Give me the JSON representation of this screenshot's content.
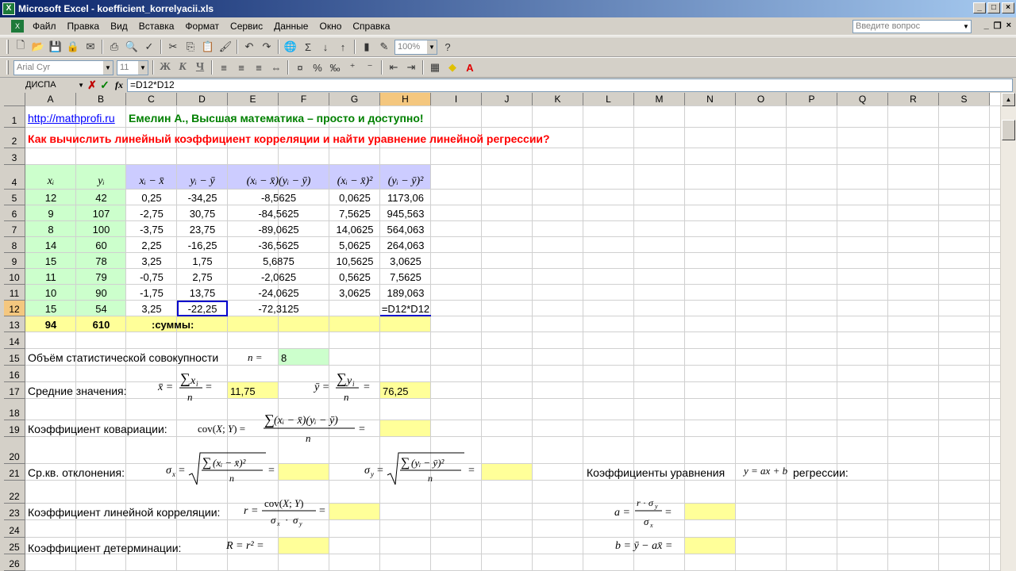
{
  "window": {
    "title": "Microsoft Excel - koefficient_korrelyacii.xls",
    "icon": "excel-icon"
  },
  "menu": {
    "items": [
      "Файл",
      "Правка",
      "Вид",
      "Вставка",
      "Формат",
      "Сервис",
      "Данные",
      "Окно",
      "Справка"
    ],
    "ask_placeholder": "Введите вопрос"
  },
  "toolbar": {
    "zoom": "100%",
    "font": "Arial Cyr",
    "font_size": "11",
    "bold": "Ж",
    "italic": "К",
    "underline": "Ч",
    "sigma": "Σ"
  },
  "formula_bar": {
    "name_box": "ДИСПА",
    "fx": "fx",
    "formula": "=D12*D12"
  },
  "columns": [
    "A",
    "B",
    "C",
    "D",
    "E",
    "F",
    "G",
    "H",
    "I",
    "J",
    "K",
    "L",
    "M",
    "N",
    "O",
    "P",
    "Q",
    "R",
    "S"
  ],
  "selected_column": "H",
  "selected_row": "12",
  "rows": [
    "1",
    "2",
    "3",
    "4",
    "5",
    "6",
    "7",
    "8",
    "9",
    "10",
    "11",
    "12",
    "13",
    "14",
    "15",
    "16",
    "17",
    "18",
    "19",
    "20",
    "21",
    "22",
    "23",
    "24",
    "25",
    "26"
  ],
  "sheet": {
    "link": "http://mathprofi.ru",
    "author": "Емелин А., Высшая математика – просто и доступно!",
    "question": "Как вычислить линейный коэффициент корреляции и найти уравнение линейной регрессии?",
    "headers": [
      "xᵢ",
      "yᵢ",
      "xᵢ − x̄",
      "yᵢ − ȳ",
      "(xᵢ − x̄)(yᵢ − ȳ)",
      "(xᵢ − x̄)²",
      "(yᵢ − ȳ)²"
    ],
    "data_rows": [
      [
        "12",
        "42",
        "0,25",
        "-34,25",
        "-8,5625",
        "0,0625",
        "1173,06"
      ],
      [
        "9",
        "107",
        "-2,75",
        "30,75",
        "-84,5625",
        "7,5625",
        "945,563"
      ],
      [
        "8",
        "100",
        "-3,75",
        "23,75",
        "-89,0625",
        "14,0625",
        "564,063"
      ],
      [
        "14",
        "60",
        "2,25",
        "-16,25",
        "-36,5625",
        "5,0625",
        "264,063"
      ],
      [
        "15",
        "78",
        "3,25",
        "1,75",
        "5,6875",
        "10,5625",
        "3,0625"
      ],
      [
        "11",
        "79",
        "-0,75",
        "2,75",
        "-2,0625",
        "0,5625",
        "7,5625"
      ],
      [
        "10",
        "90",
        "-1,75",
        "13,75",
        "-24,0625",
        "3,0625",
        "189,063"
      ],
      [
        "15",
        "54",
        "3,25",
        "-22,25",
        "-72,3125",
        "",
        "=D12*D12"
      ]
    ],
    "sum_x": "94",
    "sum_y": "610",
    "sums_label": ":суммы:",
    "n_label": "Объём статистической совокупности",
    "n_formula": "n =",
    "n_value": "8",
    "means_label": "Средние значения:",
    "mean_x_value": "11,75",
    "mean_y_value": "76,25",
    "cov_label": "Коэффициент ковариации:",
    "sd_label": "Ср.кв. отклонения:",
    "corr_label": "Коэффициент линейной корреляции:",
    "det_label": "Коэффициент детерминации:",
    "reg_label_pre": "Коэффициенты уравнения",
    "reg_label_post": "регрессии:"
  },
  "colors": {
    "green_fill": "#ccffcc",
    "blue_fill": "#ccccff",
    "yellow_fill": "#ffff99",
    "author_green": "#008000",
    "question_red": "#ff0000",
    "link_blue": "#0000ff",
    "selection_orange": "#f4c77f"
  }
}
